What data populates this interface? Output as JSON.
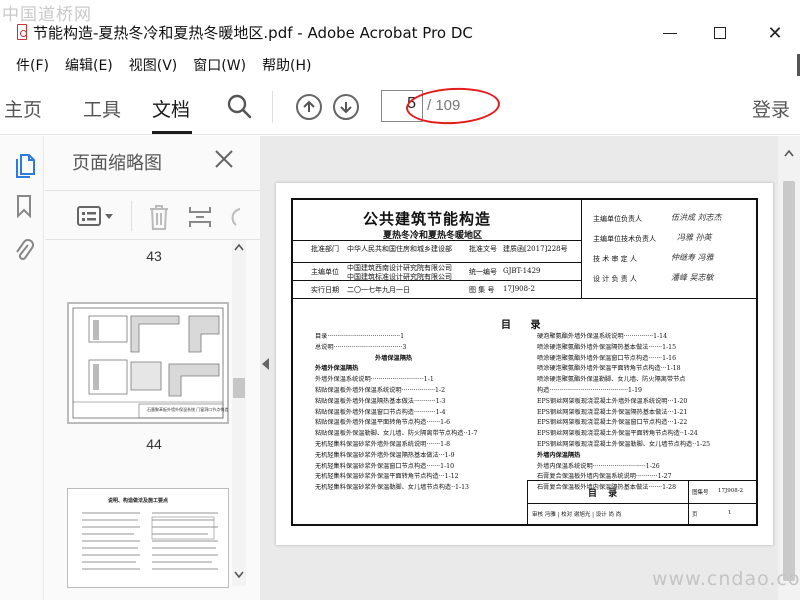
{
  "watermark_top": "中国道桥网",
  "watermark_bottom": "www.cndao.com",
  "window": {
    "title": "节能构造-夏热冬冷和夏热冬暖地区.pdf - Adobe Acrobat Pro DC",
    "min_label": "─",
    "close_label": "✕"
  },
  "menu": [
    "文件(F)",
    "编辑(E)",
    "视图(V)",
    "窗口(W)",
    "帮助(H)"
  ],
  "menu_first_visible": "件(F)",
  "toolbar": {
    "home": "主页",
    "home_visible": "主页",
    "tools": "工具",
    "document": "文档",
    "page_current": "5",
    "page_total": "/ 109",
    "login": "登录"
  },
  "panel": {
    "title": "页面缩略图",
    "pages": [
      "43",
      "44"
    ],
    "thumb_44_caption": "石墨聚苯板外墙外保温系统 门窗洞口节点构造",
    "thumb_45_caption": "说明、构造做法及施工要点"
  },
  "document": {
    "main_title": "公共建筑节能构造",
    "subtitle": "夏热冬冷和夏热冬暖地区",
    "meta": {
      "dept_label": "批准部门",
      "dept_value": "中华人民共和国住房和城乡建设部",
      "doc_no_label": "批准文号",
      "doc_no_value": "建质函[2017]228号",
      "editor_label": "主编单位",
      "editor_value_1": "中国建筑西南设计研究院有限公司",
      "editor_value_2": "中国建筑标准设计研究院有限公司",
      "unified_label": "统一编号",
      "unified_value": "GJBT-1429",
      "date_label": "实行日期",
      "date_value": "二〇一七年九月一日",
      "atlas_label": "图 集 号",
      "atlas_value": "17J908-2"
    },
    "roles": [
      {
        "role": "主编单位负责人",
        "sign": "伍洪成 刘志杰"
      },
      {
        "role": "主编单位技术负责人",
        "sign": "冯雅  孙英"
      },
      {
        "role": "技 术 审 定 人",
        "sign": "仲继寿 冯雅"
      },
      {
        "role": "设 计 负 责 人",
        "sign": "潘峰   吴志敏"
      }
    ],
    "toc_title": "目  录",
    "toc_left": [
      {
        "text": "目录·····································1",
        "bold": false
      },
      {
        "text": "总说明···································3",
        "bold": false
      },
      {
        "text": "外墙保温隔热",
        "bold": true,
        "center": true
      },
      {
        "text": "外墙外保温隔热",
        "bold": true
      },
      {
        "text": "外墙外保温系统说明···························1-1",
        "bold": false
      },
      {
        "text": "粘贴保温板外墙外保温系统说明·················1-2",
        "bold": false
      },
      {
        "text": "粘贴保温板外墙外保温隔热基本做法···········1-3",
        "bold": false
      },
      {
        "text": "粘贴保温板外墙外保温窗口节点构造···········1-4",
        "bold": false
      },
      {
        "text": "粘贴保温板外墙外保温平面转角节点构造·······1-6",
        "bold": false
      },
      {
        "text": "粘贴保温板外保温勒脚、女儿墙、防火隔离带节点构造··1-7",
        "bold": false
      },
      {
        "text": "无机轻集料保温砂浆外墙外保温系统说明·······1-8",
        "bold": false
      },
      {
        "text": "无机轻集料保温砂浆外墙外保温隔热基本做法···1-9",
        "bold": false
      },
      {
        "text": "无机轻集料保温砂浆外保温窗口节点构造·······1-10",
        "bold": false
      },
      {
        "text": "无机轻集料保温砂浆外保温平面转角节点构造···1-12",
        "bold": false
      },
      {
        "text": "无机轻集料保温砂浆外保温勒脚、女儿墙节点构造··1-13",
        "bold": false
      }
    ],
    "toc_right": [
      {
        "text": "硬泡聚氨酯外墙外保温系统说明···············1-14",
        "bold": false
      },
      {
        "text": "喷涂硬泡聚氨酯外墙外保温隔热基本做法·······1-15",
        "bold": false
      },
      {
        "text": "喷涂硬泡聚氨酯外墙外保温窗口节点构造·······1-16",
        "bold": false
      },
      {
        "text": "喷涂硬泡聚氨酯外墙外保温平面转角节点构造···1-18",
        "bold": false
      },
      {
        "text": "喷涂硬泡聚氨酯外保温勒脚、女儿墙、防火隔离带节点",
        "bold": false
      },
      {
        "text": "  构造········································1-19",
        "bold": false
      },
      {
        "text": "EPS钢丝网架板现浇混凝土外墙外保温系统说明···1-20",
        "bold": false
      },
      {
        "text": "EPS钢丝网架板现浇混凝土外保温隔热基本做法···1-21",
        "bold": false
      },
      {
        "text": "EPS钢丝网架板现浇混凝土外保温窗口节点构造···1-22",
        "bold": false
      },
      {
        "text": "EPS钢丝网架板现浇混凝土外保温平面转角节点构造··1-24",
        "bold": false
      },
      {
        "text": "EPS钢丝网架板现浇混凝土外保温勒脚、女儿墙节点构造··1-25",
        "bold": false
      },
      {
        "text": "外墙内保温隔热",
        "bold": true
      },
      {
        "text": "外墙内保温系统说明···························1-26",
        "bold": false
      },
      {
        "text": "石膏复合保温板外墙内保温系统说明···········1-27",
        "bold": false
      },
      {
        "text": "石膏复合保温板外墙内保温隔热基本做法·······1-28",
        "bold": false
      }
    ],
    "footer": {
      "label": "目  录",
      "atlas_label": "图集号",
      "atlas_value": "17J908-2",
      "row": "审核 冯雅 | 校对 谢旭光 | 设计 尚 尚",
      "page_label": "页",
      "page_value": "1"
    }
  }
}
